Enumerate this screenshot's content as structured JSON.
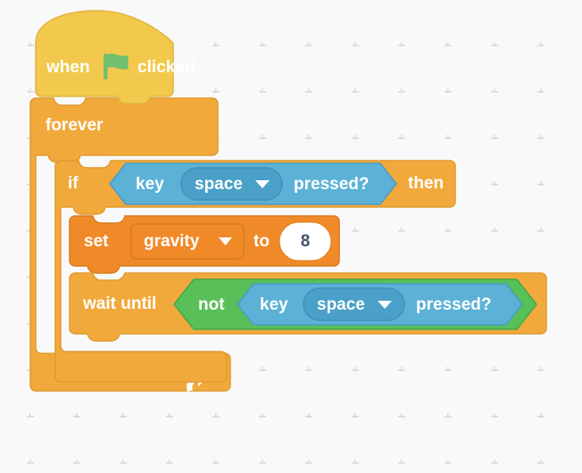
{
  "editor": {
    "name": "scratch-block-workspace",
    "background_color": "#f9f9f9",
    "grid_dot_color": "#d8d8d8"
  },
  "palette": {
    "events_yellow": "#ffbf00",
    "events_yellow_fill": "#f2c94c",
    "control_orange": "#f2a93b",
    "control_orange_stroke": "#e09a2e",
    "variables_orange": "#f08a28",
    "variables_orange_stroke": "#db7a1d",
    "sensing_blue": "#5cb1d6",
    "sensing_blue_stroke": "#4a9cc0",
    "sensing_blue_field": "#4aa0c8",
    "operators_green": "#59c059",
    "operators_green_stroke": "#46a846",
    "input_white": "#ffffff",
    "text_white": "#ffffff",
    "text_dark": "#44506b",
    "flag_green": "#6fc06f"
  },
  "script": {
    "name": "jump-with-space-script",
    "blocks": [
      {
        "id": "when-flag-clicked",
        "type": "hat",
        "category": "events",
        "label_before": "when",
        "icon": "green-flag-icon",
        "label_after": "clicked"
      },
      {
        "id": "forever",
        "type": "c-loop",
        "category": "control",
        "label": "forever",
        "loop_arrow_icon": "loop-arrow-icon"
      },
      {
        "id": "if-then",
        "type": "c-block",
        "category": "control",
        "label_before": "if",
        "label_after": "then",
        "condition": {
          "id": "key-space-pressed",
          "type": "boolean",
          "category": "sensing",
          "label_before": "key",
          "dropdown_value": "space",
          "dropdown_icon": "chevron-down-icon",
          "label_after": "pressed?"
        }
      },
      {
        "id": "set-variable",
        "type": "stack",
        "category": "variables",
        "label_before": "set",
        "dropdown_value": "gravity",
        "dropdown_icon": "chevron-down-icon",
        "label_middle": "to",
        "input_value": "8"
      },
      {
        "id": "wait-until",
        "type": "stack",
        "category": "control",
        "label": "wait until",
        "condition": {
          "id": "not-operator",
          "type": "boolean",
          "category": "operators",
          "label": "not",
          "operand": {
            "id": "key-space-pressed-2",
            "type": "boolean",
            "category": "sensing",
            "label_before": "key",
            "dropdown_value": "space",
            "dropdown_icon": "chevron-down-icon",
            "label_after": "pressed?"
          }
        }
      }
    ]
  },
  "pseudocode": "when green flag clicked / forever / if key space pressed? then / set gravity to 8 / wait until not key space pressed?"
}
